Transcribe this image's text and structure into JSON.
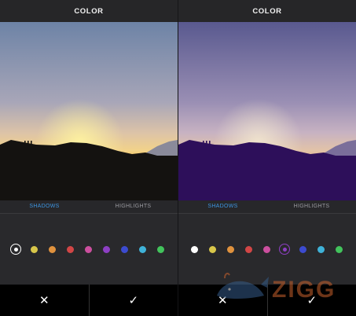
{
  "screens": [
    {
      "title": "COLOR",
      "tabs": [
        {
          "label": "SHADOWS",
          "active": true
        },
        {
          "label": "HIGHLIGHTS",
          "active": false
        }
      ],
      "overlay": "none",
      "selected_swatch": 0,
      "buttons": {
        "cancel": "✕",
        "confirm": "✓"
      }
    },
    {
      "title": "COLOR",
      "tabs": [
        {
          "label": "SHADOWS",
          "active": true
        },
        {
          "label": "HIGHLIGHTS",
          "active": false
        }
      ],
      "overlay": "purple",
      "selected_swatch": 5,
      "buttons": {
        "cancel": "✕",
        "confirm": "✓"
      }
    }
  ],
  "swatch_colors": [
    "#ffffff",
    "#d8c64a",
    "#e0923e",
    "#d24646",
    "#cc4f9f",
    "#8d3fc4",
    "#3c4bd0",
    "#3fb2d8",
    "#42c35c"
  ],
  "watermark": {
    "text": "ZIGG",
    "brand_color": "#355c8a",
    "accent": "#c9622d"
  }
}
